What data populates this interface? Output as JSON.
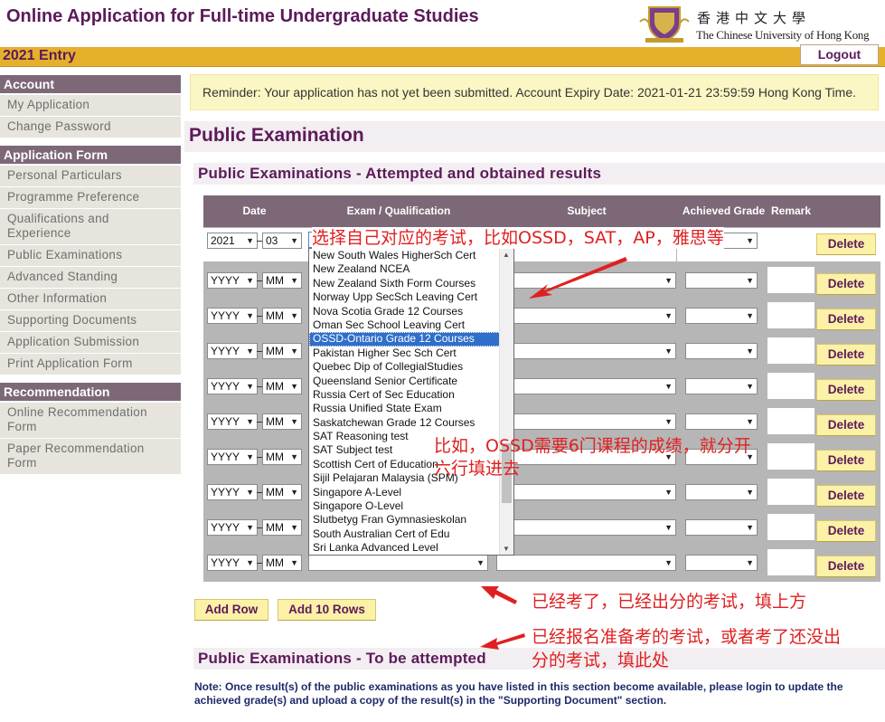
{
  "header": {
    "app_title": "Online Application for Full-time Undergraduate Studies",
    "entry": "2021 Entry",
    "logout_label": "Logout",
    "logo_cn": "香港中文大學",
    "logo_en": "The Chinese University of Hong Kong"
  },
  "sidebar": {
    "account": {
      "title": "Account",
      "items": [
        "My Application",
        "Change Password"
      ]
    },
    "application_form": {
      "title": "Application Form",
      "items": [
        "Personal Particulars",
        "Programme Preference",
        "Qualifications and Experience",
        "Public Examinations",
        "Advanced Standing",
        "Other Information",
        "Supporting Documents",
        "Application Submission",
        "Print Application Form"
      ]
    },
    "recommendation": {
      "title": "Recommendation",
      "items": [
        "Online Recommendation Form",
        "Paper Recommendation Form"
      ]
    }
  },
  "reminder": "Reminder: Your application has not yet been submitted. Account Expiry Date: 2021-01-21 23:59:59 Hong Kong Time.",
  "page_title": "Public Examination",
  "section_attempted": "Public Examinations - Attempted and obtained results",
  "section_to_attempt": "Public Examinations - To be attempted",
  "table": {
    "headers": {
      "date": "Date",
      "exam": "Exam / Qualification",
      "subject": "Subject",
      "grade": "Achieved Grade",
      "remark": "Remark"
    },
    "first_row": {
      "year": "2021",
      "month": "03"
    },
    "placeholder_year": "YYYY",
    "placeholder_month": "MM",
    "delete_label": "Delete"
  },
  "dropdown_options": [
    "New South Wales HigherSch Cert",
    "New Zealand NCEA",
    "New Zealand Sixth Form Courses",
    "Norway Upp SecSch Leaving Cert",
    "Nova Scotia Grade 12 Courses",
    "Oman Sec School Leaving Cert",
    "OSSD-Ontario Grade 12 Courses",
    "Pakistan Higher Sec Sch Cert",
    "Quebec Dip of CollegialStudies",
    "Queensland Senior Certificate",
    "Russia Cert of Sec Education",
    "Russia Unified State Exam",
    "Saskatchewan Grade 12 Courses",
    "SAT Reasoning test",
    "SAT Subject test",
    "Scottish Cert of Education",
    "Sijil Pelajaran Malaysia (SPM)",
    "Singapore A-Level",
    "Singapore O-Level",
    "Slutbetyg Fran Gymnasieskolan",
    "South Australian Cert of Edu",
    "Sri Lanka Advanced Level"
  ],
  "dropdown_selected_index": 6,
  "buttons": {
    "add_row": "Add Row",
    "add_10_rows": "Add 10 Rows"
  },
  "note": "Note: Once result(s) of the public examinations as you have listed in this section become available, please login to update the achieved grade(s) and upload a copy of the result(s) in the \"Supporting Document\" section.",
  "annotations": {
    "choose_exam": "选择自己对应的考试，比如OSSD，SAT，AP，雅思等",
    "ossd_line1": "比如，OSSD需要6门课程的成绩，就分开",
    "ossd_line2": "六行填进去",
    "above": "已经考了，已经出分的考试，填上方",
    "below_line1": "已经报名准备考的考试，或者考了还没出",
    "below_line2": "分的考试，填此处"
  }
}
